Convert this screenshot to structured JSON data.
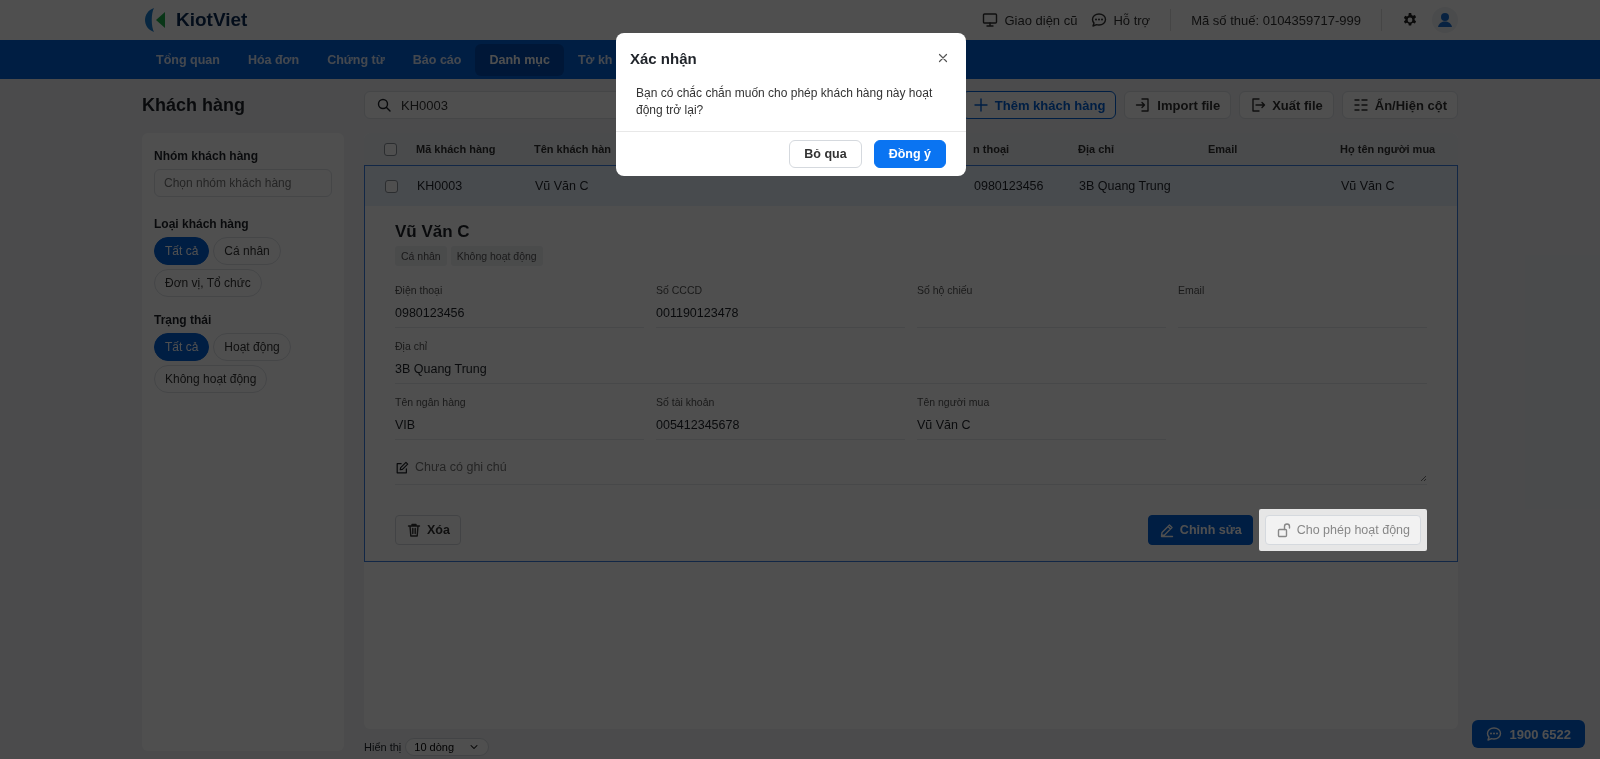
{
  "header": {
    "brand": "KiotViet",
    "links": [
      {
        "label": "Giao diện cũ",
        "kind": "monitor"
      },
      {
        "label": "Hỗ trợ",
        "kind": "chat"
      }
    ],
    "tax_id": "Mã số thuế: 0104359717-999"
  },
  "nav": [
    {
      "label": "Tổng quan",
      "selected": false
    },
    {
      "label": "Hóa đơn",
      "selected": false
    },
    {
      "label": "Chứng từ",
      "selected": false
    },
    {
      "label": "Báo cáo",
      "selected": false
    },
    {
      "label": "Danh mục",
      "selected": true
    },
    {
      "label": "Tờ kh",
      "selected": false
    }
  ],
  "page_title": "Khách hàng",
  "search": {
    "value": "KH0003"
  },
  "toolbar": [
    {
      "label": "Thêm khách hàng",
      "kind": "add"
    },
    {
      "label": "Import file",
      "kind": "import"
    },
    {
      "label": "Xuất file",
      "kind": "export"
    },
    {
      "label": "Ẩn/Hiện cột",
      "kind": "columns"
    }
  ],
  "sidebar": {
    "group_filter": {
      "label": "Nhóm khách hàng",
      "placeholder": "Chọn nhóm khách hàng"
    },
    "filters": [
      {
        "label": "Loại khách hàng",
        "options": [
          {
            "label": "Tất cả",
            "selected": true
          },
          {
            "label": "Cá nhân",
            "selected": false
          },
          {
            "label": "Đơn vị, Tổ chức",
            "selected": false
          }
        ]
      },
      {
        "label": "Trạng thái",
        "options": [
          {
            "label": "Tất cả",
            "selected": true
          },
          {
            "label": "Hoạt động",
            "selected": false
          },
          {
            "label": "Không hoạt động",
            "selected": false
          }
        ]
      }
    ]
  },
  "table": {
    "all_checked": false,
    "columns": [
      "Mã khách hàng",
      "Tên khách hàn",
      "n thoại",
      "Địa chỉ",
      "Email",
      "Họ tên người mua"
    ],
    "rows": [
      {
        "checked": false,
        "expanded": true,
        "cells": [
          "KH0003",
          "Vũ Văn C",
          "0980123456",
          "3B Quang Trung",
          null,
          "Vũ Văn C"
        ]
      }
    ]
  },
  "detail": {
    "name": "Vũ Văn C",
    "tags": [
      "Cá nhân",
      "Không hoạt động"
    ],
    "field_rows": [
      [
        {
          "label": "Điện thoại",
          "value": "0980123456"
        },
        {
          "label": "Số CCCD",
          "value": "001190123478"
        },
        {
          "label": "Số hộ chiếu"
        },
        {
          "label": "Email"
        }
      ],
      [
        {
          "label": "Địa chỉ",
          "value": "3B Quang Trung"
        }
      ],
      [
        {
          "label": "Tên ngân hàng",
          "value": "VIB"
        },
        {
          "label": "Số tài khoản",
          "value": "005412345678"
        },
        {
          "label": "Tên người mua",
          "value": "Vũ Văn C"
        }
      ]
    ],
    "note": {
      "placeholder": "Chưa có ghi chú"
    },
    "actions": [
      {
        "label": "Xóa",
        "kind": "delete",
        "highlighted": false
      },
      {
        "label": "Chỉnh sửa",
        "kind": "edit",
        "highlighted": false
      },
      {
        "label": "Cho phép hoạt động",
        "kind": "activate",
        "highlighted": true
      }
    ]
  },
  "footer": {
    "label": "Hiển thị",
    "page_size": "10 dòng"
  },
  "hotline": "1900 6522",
  "dialog": {
    "title": "Xác nhận",
    "message": "Bạn có chắc chắn muốn cho phép khách hàng này hoạt động trở lại?",
    "buttons": [
      {
        "label": "Bỏ qua",
        "kind": "secondary"
      },
      {
        "label": "Đồng ý",
        "kind": "primary"
      }
    ]
  }
}
